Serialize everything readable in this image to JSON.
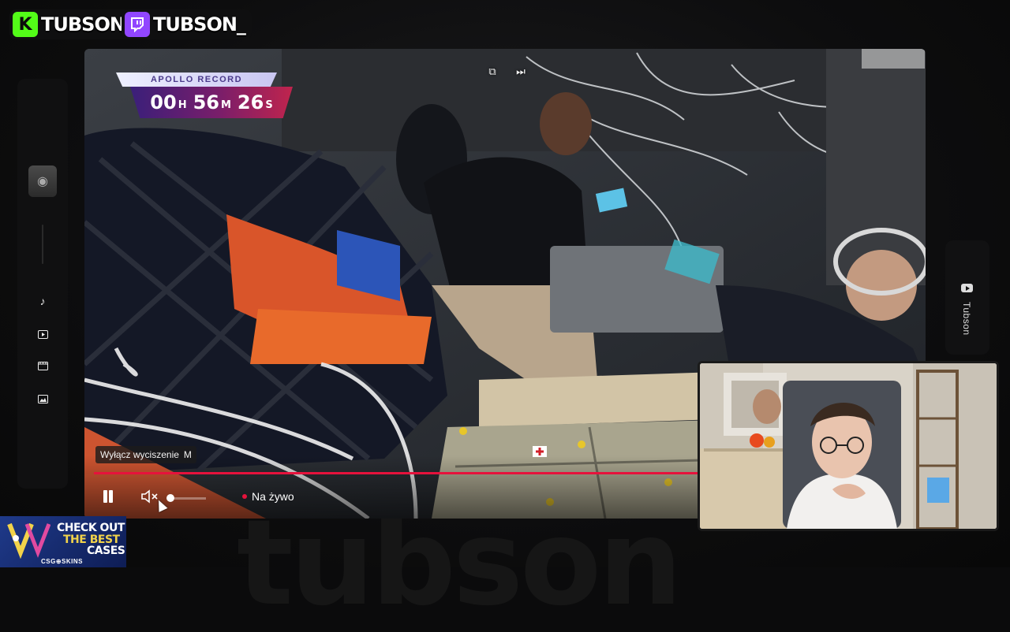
{
  "streamer": {
    "kick_name": "TUBSON",
    "twitch_name": "TUBSON_",
    "watermark_text": "tubson",
    "right_sidebar_label": "Tubson"
  },
  "overlay": {
    "apollo_label": "APOLLO RECORD",
    "timer": {
      "hours": "00",
      "hours_unit": "H",
      "minutes": "56",
      "minutes_unit": "M",
      "seconds": "26",
      "seconds_unit": "S"
    }
  },
  "player": {
    "tooltip_text": "Wyłącz wyciszenie",
    "tooltip_key": "M",
    "live_label": "Na żywo",
    "progress_color": "#e6123c",
    "volume_level": 0.0
  },
  "left_sidebar": {
    "icons": [
      "music-icon",
      "video-icon",
      "film-icon",
      "image-icon"
    ]
  },
  "sponsor": {
    "line1": "CHECK OUT",
    "line2": "THE BEST",
    "line3": "CASES",
    "brand": "CSG⊕SKINS"
  },
  "colors": {
    "kick_green": "#53fc18",
    "twitch_purple": "#9146ff",
    "live_red": "#e6123c"
  }
}
